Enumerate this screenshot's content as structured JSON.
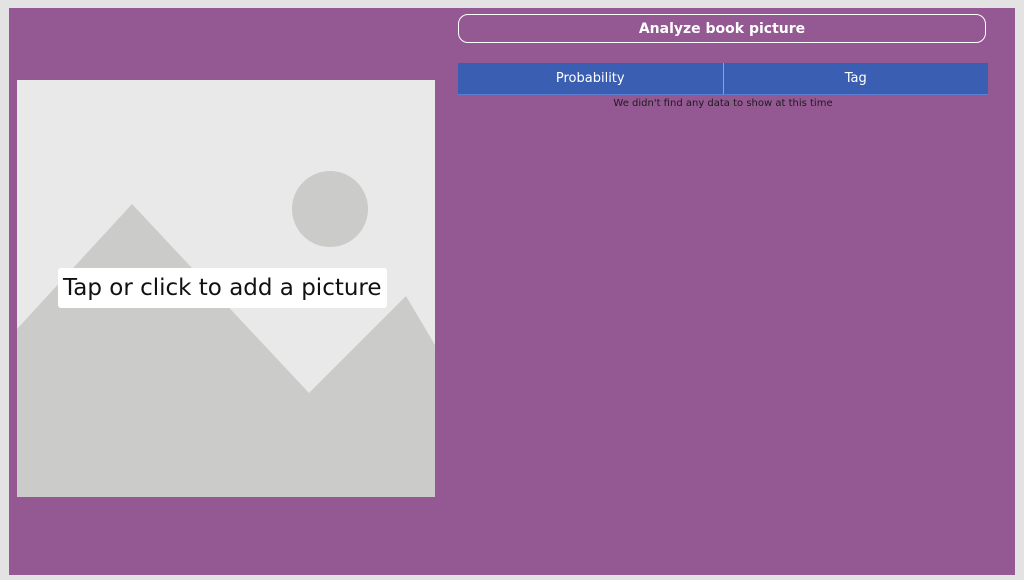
{
  "app": {
    "analyze_button_label": "Analyze book picture",
    "add_picture": {
      "label": "Tap or click to add a picture",
      "icon": "image-placeholder-icon"
    },
    "results_table": {
      "columns": [
        "Probability",
        "Tag"
      ],
      "empty_message": "We didn't find any data to show at this time",
      "rows": []
    }
  },
  "colors": {
    "canvas_background": "#945893",
    "table_header": "#3a5fb2",
    "placeholder_background": "#e9e9e9",
    "placeholder_shapes": "#cbcbc9",
    "button_text": "#ffffff"
  }
}
